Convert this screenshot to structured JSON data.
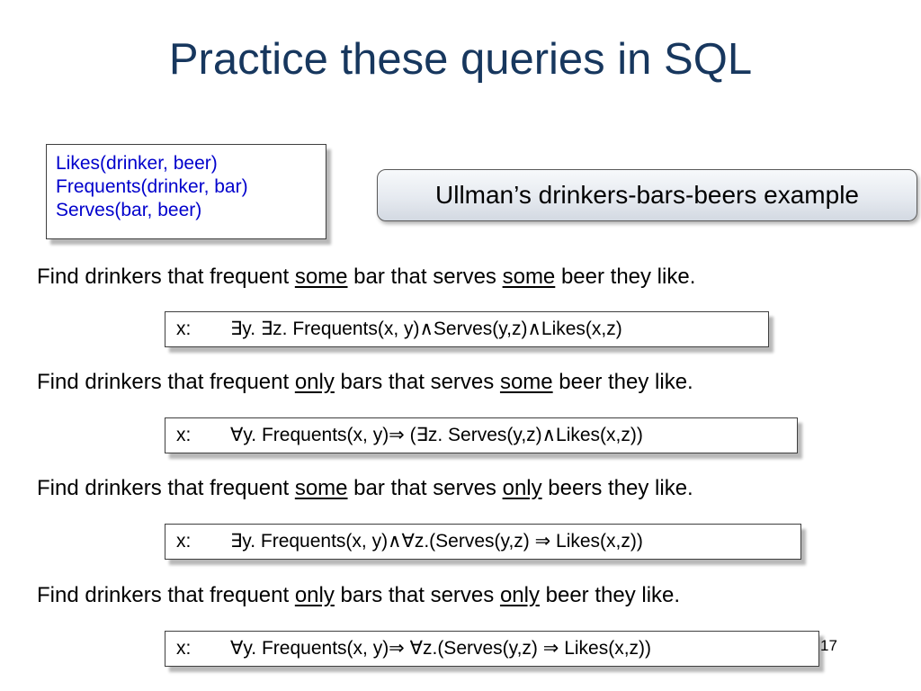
{
  "slide": {
    "title": "Practice these queries in SQL",
    "schema": [
      "Likes(drinker, beer)",
      "Frequents(drinker, bar)",
      "Serves(bar, beer)"
    ],
    "example_label": "Ullman’s drinkers-bars-beers example",
    "page_number": "17",
    "colors": {
      "title": "#17375e",
      "schema_text": "#0000cc"
    }
  },
  "questions": [
    {
      "prefix": "Find drinkers that frequent ",
      "q1": "some",
      "middle": " bar that serves ",
      "q2": "some",
      "suffix": " beer they like.",
      "formula_var": "x:",
      "formula": "∃y. ∃z. Frequents(x, y)∧Serves(y,z)∧Likes(x,z)"
    },
    {
      "prefix": "Find drinkers that frequent ",
      "q1": "only",
      "middle": " bars that serves ",
      "q2": "some",
      "suffix": " beer they like.",
      "formula_var": "x:",
      "formula": "∀y. Frequents(x, y)⇒ (∃z. Serves(y,z)∧Likes(x,z))"
    },
    {
      "prefix": "Find drinkers that frequent ",
      "q1": "some",
      "middle": " bar that serves ",
      "q2": "only",
      "suffix": " beers they like.",
      "formula_var": "x:",
      "formula": "∃y. Frequents(x, y)∧∀z.(Serves(y,z) ⇒ Likes(x,z))"
    },
    {
      "prefix": "Find drinkers that frequent ",
      "q1": "only",
      "middle": " bars that serves ",
      "q2": "only",
      "suffix": " beer they like.",
      "formula_var": "x:",
      "formula": "∀y. Frequents(x, y)⇒ ∀z.(Serves(y,z) ⇒ Likes(x,z))"
    }
  ]
}
